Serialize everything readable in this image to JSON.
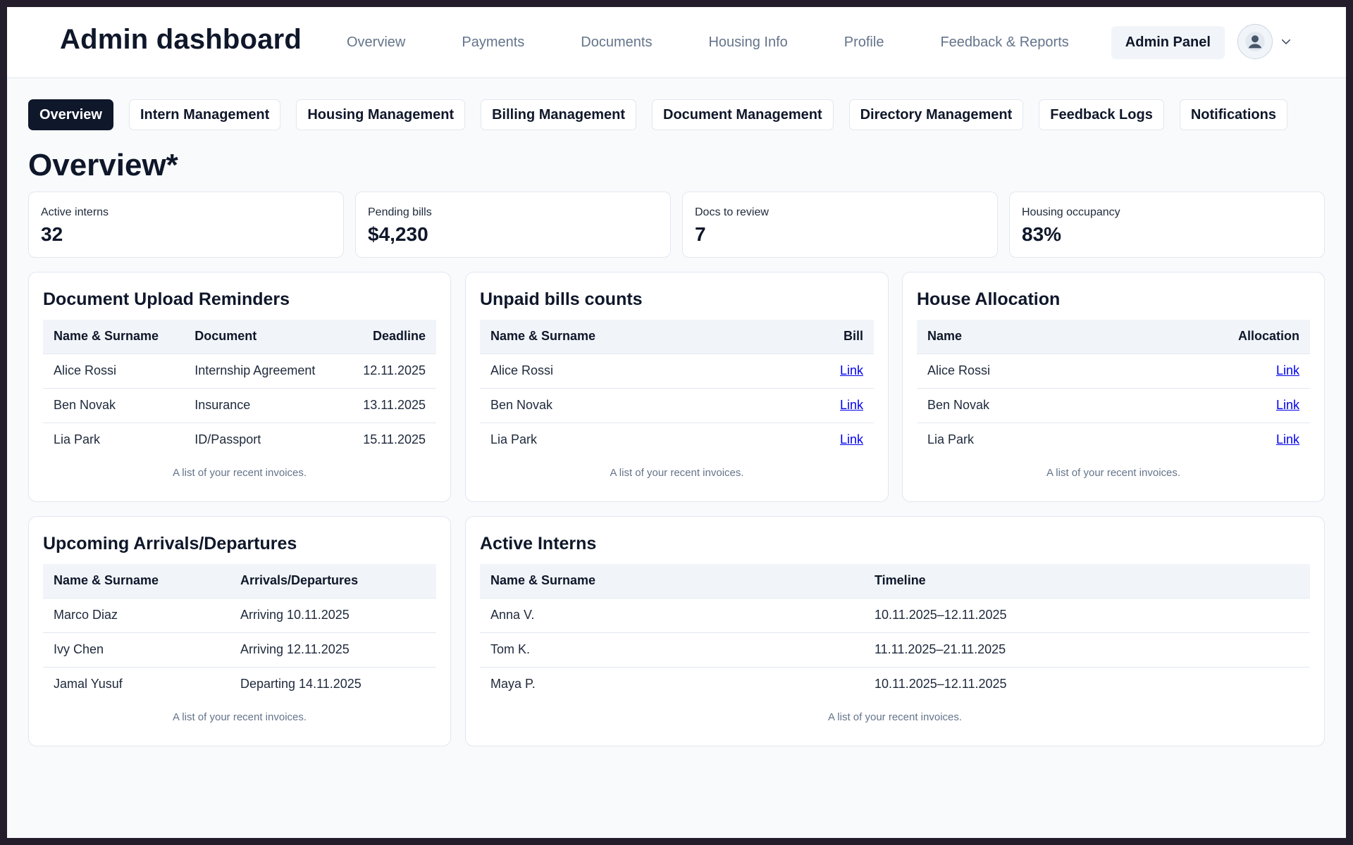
{
  "header": {
    "brand": "Admin dashboard",
    "nav": [
      "Overview",
      "Payments",
      "Documents",
      "Housing Info",
      "Profile",
      "Feedback & Reports",
      "Admin Panel"
    ],
    "active_nav": "Admin Panel",
    "avatar_icon": "user-avatar-icon",
    "menu_icon": "chevron-down-icon"
  },
  "tabs": [
    "Overview",
    "Intern Management",
    "Housing Management",
    "Billing Management",
    "Document Management",
    "Directory Management",
    "Feedback Logs",
    "Notifications"
  ],
  "page_title": "Overview*",
  "stats": [
    {
      "label": "Active interns",
      "value": "32"
    },
    {
      "label": "Pending bills",
      "value": "$4,230"
    },
    {
      "label": "Docs to review",
      "value": "7"
    },
    {
      "label": "Housing occupancy",
      "value": "83%"
    }
  ],
  "cards": {
    "doc_reminders": {
      "title": "Document Upload Reminders",
      "columns": [
        "Name & Surname",
        "Document",
        "Deadline"
      ],
      "rows": [
        [
          "Alice Rossi",
          "Internship Agreement",
          "12.11.2025"
        ],
        [
          "Ben Novak",
          "Insurance",
          "13.11.2025"
        ],
        [
          "Lia Park",
          "ID/Passport",
          "15.11.2025"
        ]
      ],
      "caption": "A list of your recent invoices."
    },
    "unpaid_bills": {
      "title": "Unpaid bills counts",
      "columns": [
        "Name & Surname",
        "Bill"
      ],
      "rows": [
        [
          "Alice Rossi",
          "Link"
        ],
        [
          "Ben Novak",
          "Link"
        ],
        [
          "Lia Park",
          "Link"
        ]
      ],
      "caption": "A list of your recent invoices."
    },
    "house_allocation": {
      "title": "House Allocation",
      "columns": [
        "Name",
        "Allocation"
      ],
      "rows": [
        [
          "Alice Rossi",
          "Link"
        ],
        [
          "Ben Novak",
          "Link"
        ],
        [
          "Lia Park",
          "Link"
        ]
      ],
      "caption": "A list of your recent invoices."
    },
    "arrivals": {
      "title": "Upcoming Arrivals/Departures",
      "columns": [
        "Name & Surname",
        "Arrivals/Departures"
      ],
      "rows": [
        [
          "Marco Diaz",
          "Arriving 10.11.2025"
        ],
        [
          "Ivy Chen",
          "Arriving 12.11.2025"
        ],
        [
          "Jamal Yusuf",
          "Departing 14.11.2025"
        ]
      ],
      "caption": "A list of your recent invoices."
    },
    "active_interns": {
      "title": "Active Interns",
      "columns": [
        "Name & Surname",
        "Timeline"
      ],
      "rows": [
        [
          "Anna V.",
          "10.11.2025–12.11.2025"
        ],
        [
          "Tom K.",
          "11.11.2025–21.11.2025"
        ],
        [
          "Maya P.",
          "10.11.2025–12.11.2025"
        ]
      ],
      "caption": "A list of your recent invoices."
    }
  }
}
